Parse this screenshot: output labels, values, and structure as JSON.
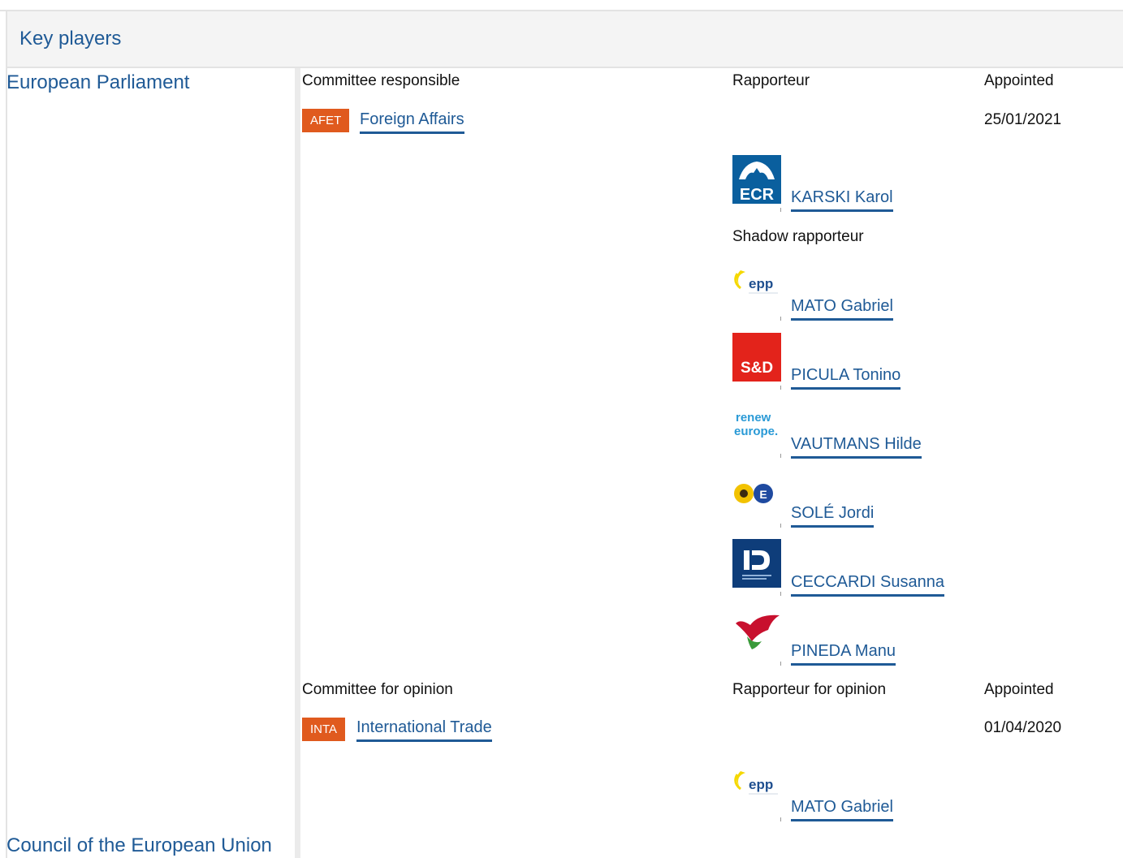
{
  "header": {
    "title": "Key players"
  },
  "institutions": {
    "parliament": "European Parliament",
    "council": "Council of the European Union"
  },
  "responsible": {
    "committee_header": "Committee responsible",
    "rapporteur_header": "Rapporteur",
    "appointed_header": "Appointed",
    "committee_code": "AFET",
    "committee_name": "Foreign Affairs",
    "appointed_date": "25/01/2021",
    "rapporteur": {
      "name": "KARSKI Karol",
      "group_logo": "ecr-logo",
      "group_logo_text": "ECR"
    },
    "shadow_header": "Shadow rapporteur",
    "shadows": [
      {
        "name": "MATO Gabriel",
        "group_logo": "epp-logo",
        "group_logo_text": "epp"
      },
      {
        "name": "PICULA Tonino",
        "group_logo": "sd-logo",
        "group_logo_text": "S&D"
      },
      {
        "name": "VAUTMANS Hilde",
        "group_logo": "renew-logo",
        "group_logo_text": "renew europe."
      },
      {
        "name": "SOLÉ Jordi",
        "group_logo": "greens-efa-logo"
      },
      {
        "name": "CECCARDI Susanna",
        "group_logo": "id-logo"
      },
      {
        "name": "PINEDA Manu",
        "group_logo": "gue-ngl-logo"
      }
    ]
  },
  "opinion": {
    "committee_header": "Committee for opinion",
    "rapporteur_header": "Rapporteur for opinion",
    "appointed_header": "Appointed",
    "committee_code": "INTA",
    "committee_name": "International Trade",
    "appointed_date": "01/04/2020",
    "rapporteur": {
      "name": "MATO Gabriel",
      "group_logo": "epp-logo",
      "group_logo_text": "epp"
    }
  },
  "colors": {
    "link": "#1f5a96",
    "badge": "#e05a1e",
    "header_bg": "#f4f4f4",
    "ecr": "#0a5f9e",
    "sd": "#e3231b",
    "id": "#0e3d7a",
    "gue": "#c8102e"
  }
}
